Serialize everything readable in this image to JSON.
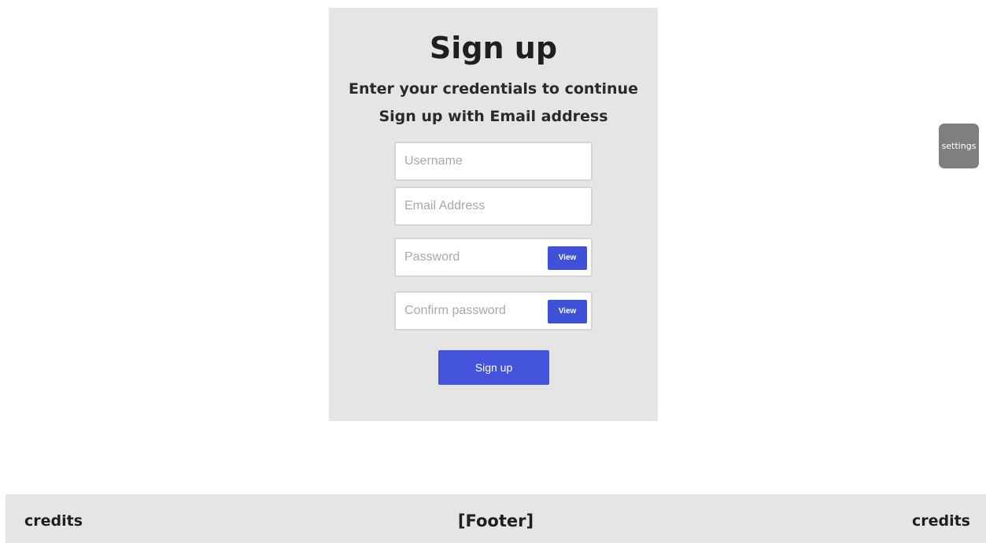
{
  "form": {
    "title": "Sign up",
    "subtitle": "Enter your credentials to continue",
    "method_label": "Sign up with Email address",
    "username": {
      "value": "",
      "placeholder": "Username"
    },
    "email": {
      "value": "",
      "placeholder": "Email Address"
    },
    "password": {
      "value": "",
      "placeholder": "Password",
      "view_label": "View"
    },
    "confirm_password": {
      "value": "",
      "placeholder": "Confirm password",
      "view_label": "View"
    },
    "submit_label": "Sign up"
  },
  "settings": {
    "label": "settings"
  },
  "footer": {
    "left_label": "credits",
    "center_label": "[Footer]",
    "right_label": "credits"
  },
  "colors": {
    "card_bg": "#e5e5e6",
    "accent": "#4353db",
    "settings_bg": "#7f7f7f",
    "footer_bg": "#e5e5e6"
  }
}
